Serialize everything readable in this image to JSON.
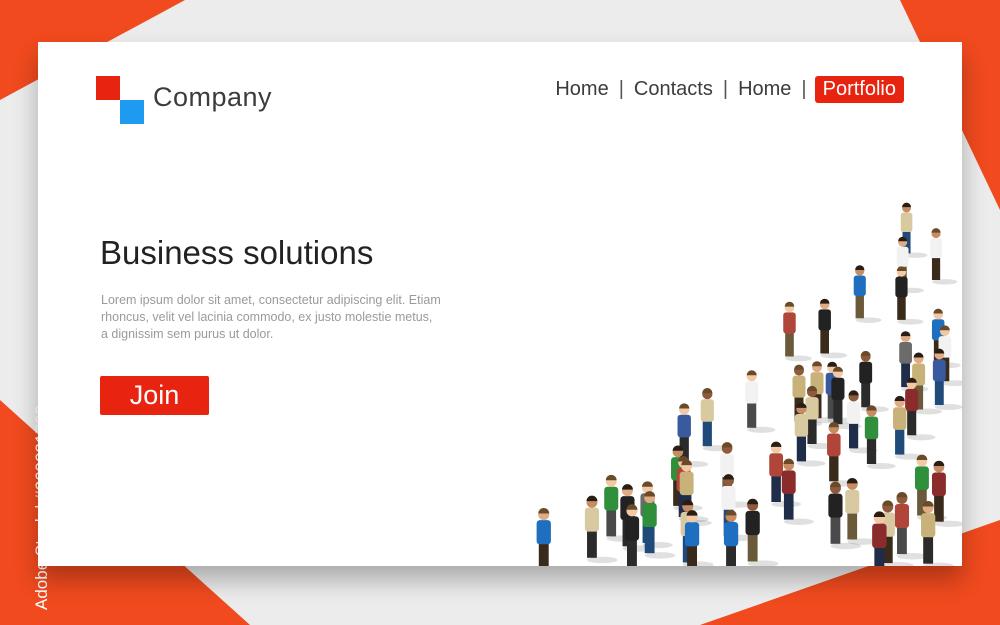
{
  "brand": {
    "name": "Company"
  },
  "nav": {
    "items": [
      {
        "label": "Home"
      },
      {
        "label": "Contacts"
      },
      {
        "label": "Home"
      },
      {
        "label": "Portfolio"
      }
    ],
    "active_index": 3
  },
  "hero": {
    "headline": "Business solutions",
    "body": "Lorem ipsum dolor sit amet, consectetur adipiscing elit. Etiam rhoncus, velit vel lacinia commodo, ex justo molestie metus, a dignissim sem purus ut dolor.",
    "cta_label": "Join"
  },
  "watermark": {
    "text": "Adobe Stock | #269021700"
  },
  "colors": {
    "accent": "#e8230f",
    "accent2": "#1e9bf0",
    "background": "#ececec",
    "panel": "#ffffff"
  }
}
